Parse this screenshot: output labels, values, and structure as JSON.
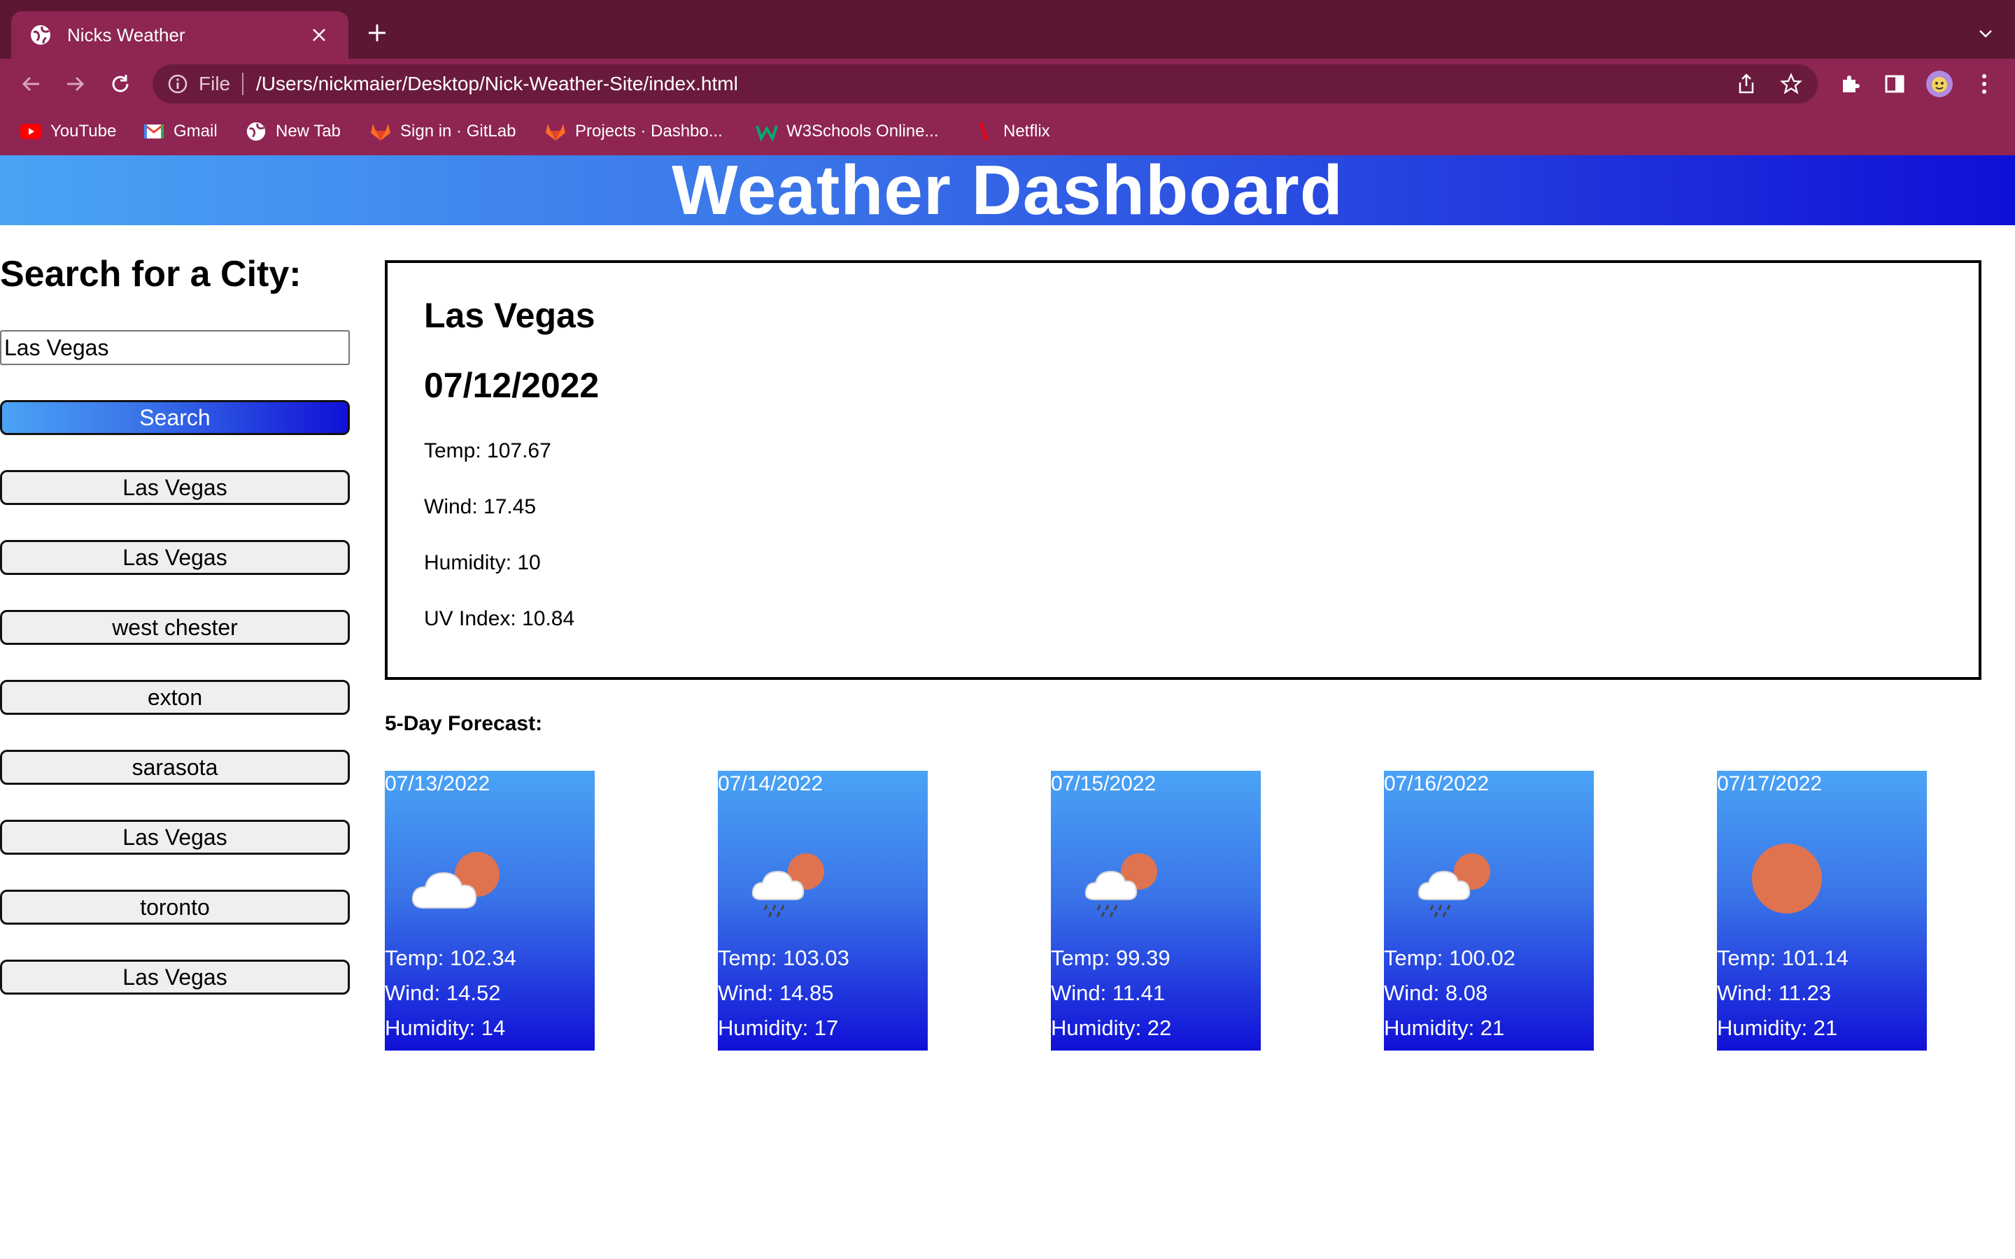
{
  "browser": {
    "tab_title": "Nicks Weather",
    "omnibox_scheme": "File",
    "url": "/Users/nickmaier/Desktop/Nick-Weather-Site/index.html",
    "bookmarks": [
      {
        "label": "YouTube",
        "icon": "youtube-icon"
      },
      {
        "label": "Gmail",
        "icon": "gmail-icon"
      },
      {
        "label": "New Tab",
        "icon": "globe-icon"
      },
      {
        "label": "Sign in · GitLab",
        "icon": "gitlab-icon"
      },
      {
        "label": "Projects · Dashbo...",
        "icon": "gitlab-icon"
      },
      {
        "label": "W3Schools Online...",
        "icon": "w3schools-icon"
      },
      {
        "label": "Netflix",
        "icon": "netflix-icon"
      }
    ]
  },
  "header": {
    "title": "Weather Dashboard"
  },
  "sidebar": {
    "heading": "Search for a City:",
    "search_value": "Las Vegas",
    "search_button": "Search",
    "history": [
      "Las Vegas",
      "Las Vegas",
      "west chester",
      "exton",
      "sarasota",
      "Las Vegas",
      "toronto",
      "Las Vegas"
    ]
  },
  "current": {
    "city": "Las Vegas",
    "date": "07/12/2022",
    "temp": "Temp: 107.67",
    "wind": "Wind: 17.45",
    "humidity": "Humidity: 10",
    "uv": "UV Index: 10.84"
  },
  "forecast": {
    "label": "5-Day Forecast:",
    "days": [
      {
        "date": "07/13/2022",
        "icon": "partly-cloudy-icon",
        "temp": "Temp: 102.34",
        "wind": "Wind: 14.52",
        "humidity": "Humidity: 14"
      },
      {
        "date": "07/14/2022",
        "icon": "rain-sun-icon",
        "temp": "Temp: 103.03",
        "wind": "Wind: 14.85",
        "humidity": "Humidity: 17"
      },
      {
        "date": "07/15/2022",
        "icon": "rain-sun-icon",
        "temp": "Temp: 99.39",
        "wind": "Wind: 11.41",
        "humidity": "Humidity: 22"
      },
      {
        "date": "07/16/2022",
        "icon": "rain-sun-icon",
        "temp": "Temp: 100.02",
        "wind": "Wind: 8.08",
        "humidity": "Humidity: 21"
      },
      {
        "date": "07/17/2022",
        "icon": "sun-icon",
        "temp": "Temp: 101.14",
        "wind": "Wind: 11.23",
        "humidity": "Humidity: 21"
      }
    ]
  },
  "colors": {
    "chrome_dark": "#5c1733",
    "chrome_light": "#8e2552",
    "gradient_start": "#4aa3f5",
    "gradient_end": "#1010d6",
    "sun": "#e0734f"
  }
}
